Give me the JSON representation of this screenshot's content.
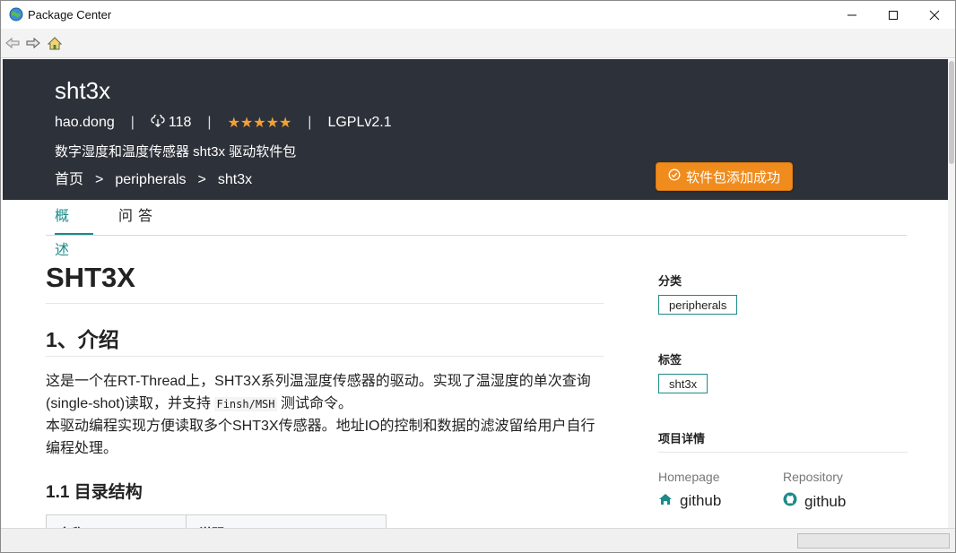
{
  "window": {
    "title": "Package Center"
  },
  "package": {
    "name": "sht3x",
    "author": "hao.dong",
    "downloads": "118",
    "rating": "★★★★★",
    "license": "LGPLv2.1",
    "description": "数字湿度和温度传感器 sht3x 驱动软件包",
    "breadcrumb": [
      "首页",
      "peripherals",
      "sht3x"
    ],
    "breadcrumb_sep": ">",
    "meta_sep": "|",
    "added_label": "软件包添加成功"
  },
  "tabs": [
    {
      "label": "概述",
      "active": true
    },
    {
      "label": "问答",
      "active": false
    }
  ],
  "content": {
    "h1": "SHT3X",
    "h2": "1、介绍",
    "para1_a": "这是一个在RT-Thread上，SHT3X系列温湿度传感器的驱动。实现了温湿度的单次查询(single-shot)读取，并支持 ",
    "para1_code": "Finsh/MSH",
    "para1_b": " 测试命令。",
    "para2": "本驱动编程实现方便读取多个SHT3X传感器。地址IO的控制和数据的滤波留给用户自行编程处理。",
    "h3": "1.1 目录结构",
    "table_headers": [
      "名称",
      "说明"
    ]
  },
  "sidebar": {
    "category_heading": "分类",
    "category": "peripherals",
    "tags_heading": "标签",
    "tag": "sht3x",
    "details_heading": "项目详情",
    "homepage_label": "Homepage",
    "homepage_link": "github",
    "repository_label": "Repository",
    "repository_link": "github"
  },
  "colors": {
    "hero_bg": "#2d3139",
    "accent": "#1d8a8a",
    "star": "#f0a13a",
    "added_button": "#f08c1e"
  },
  "icons": {
    "app": "globe-icon",
    "back": "back-arrow-icon",
    "forward": "forward-arrow-icon",
    "home": "home-icon",
    "download": "cloud-download-icon",
    "check": "check-circle-icon",
    "homepage": "house-icon",
    "repository": "github-icon"
  }
}
